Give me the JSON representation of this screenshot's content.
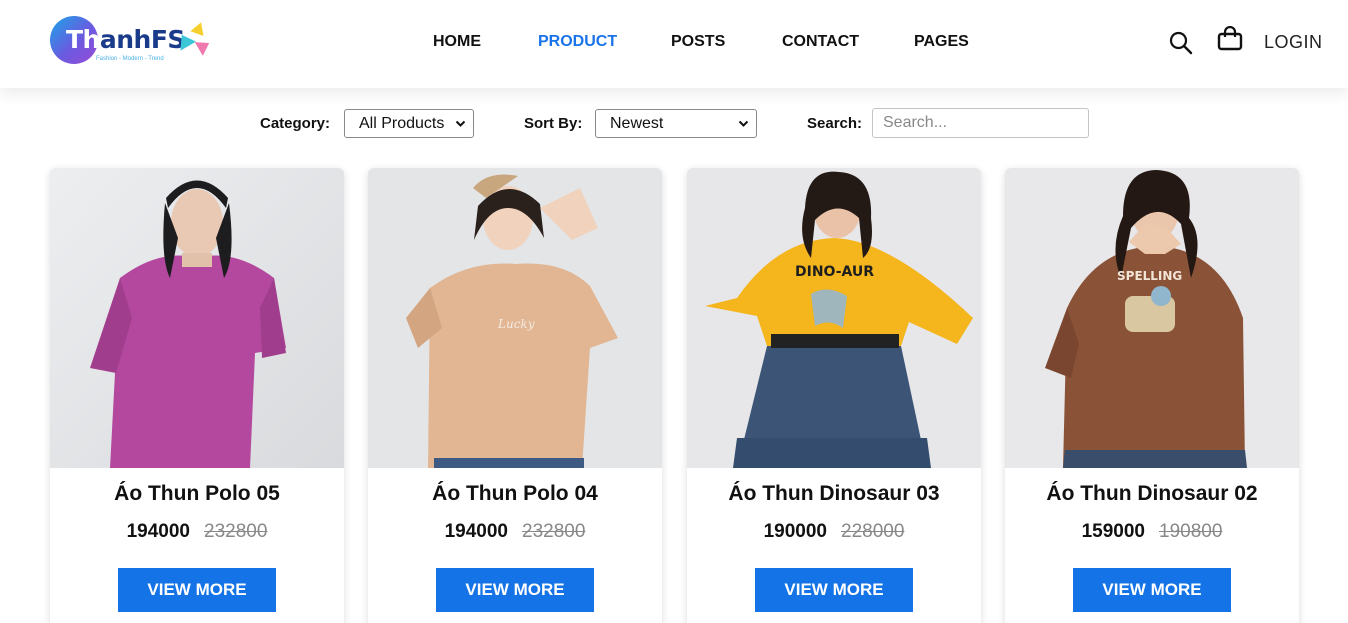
{
  "header": {
    "logo": {
      "text_first": "Th",
      "text_rest": "anhFS",
      "tagline": "Fashion - Modern - Trend"
    },
    "nav": [
      {
        "label": "HOME",
        "active": false
      },
      {
        "label": "PRODUCT",
        "active": true
      },
      {
        "label": "POSTS",
        "active": false
      },
      {
        "label": "CONTACT",
        "active": false
      },
      {
        "label": "PAGES",
        "active": false
      }
    ],
    "search_icon": "search-icon",
    "cart_icon": "shopping-bag-icon",
    "login_label": "LOGIN"
  },
  "filters": {
    "category_label": "Category:",
    "category_value": "All Products",
    "sort_label": "Sort By:",
    "sort_value": "Newest",
    "search_label": "Search:",
    "search_placeholder": "Search...",
    "search_value": ""
  },
  "products": [
    {
      "name": "Áo Thun Polo 05",
      "price": "194000",
      "old_price": "232800",
      "button": "VIEW MORE",
      "shirt_color": "#b4489e"
    },
    {
      "name": "Áo Thun Polo 04",
      "price": "194000",
      "old_price": "232800",
      "button": "VIEW MORE",
      "shirt_color": "#e2b692"
    },
    {
      "name": "Áo Thun Dinosaur 03",
      "price": "190000",
      "old_price": "228000",
      "button": "VIEW MORE",
      "shirt_color": "#f4b51d"
    },
    {
      "name": "Áo Thun Dinosaur 02",
      "price": "159000",
      "old_price": "190800",
      "button": "VIEW MORE",
      "shirt_color": "#8a5236"
    }
  ],
  "colors": {
    "accent": "#1a73e8",
    "button": "#1473e6"
  }
}
